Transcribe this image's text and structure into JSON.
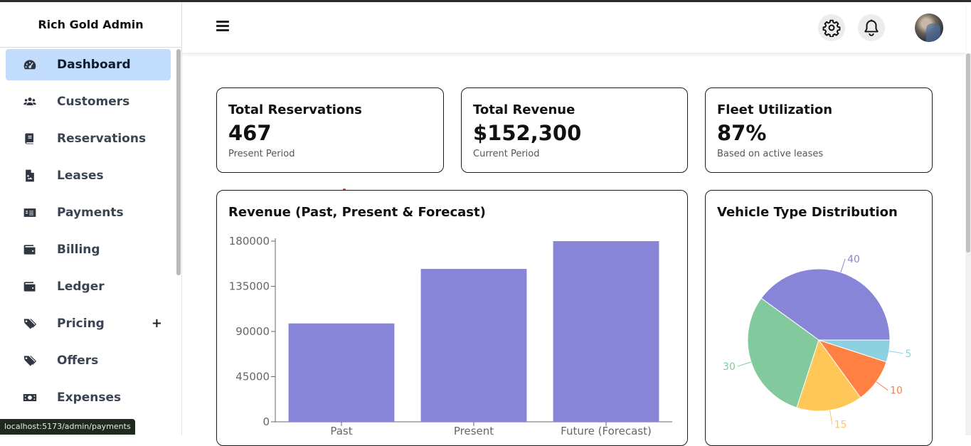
{
  "sidebar": {
    "brand": "Rich Gold Admin",
    "items": [
      {
        "label": "Dashboard",
        "icon": "dashboard-icon",
        "active": true
      },
      {
        "label": "Customers",
        "icon": "users-icon"
      },
      {
        "label": "Reservations",
        "icon": "book-icon"
      },
      {
        "label": "Leases",
        "icon": "file-image-icon"
      },
      {
        "label": "Payments",
        "icon": "money-check-icon"
      },
      {
        "label": "Billing",
        "icon": "wallet-icon"
      },
      {
        "label": "Ledger",
        "icon": "wallet-icon"
      },
      {
        "label": "Pricing",
        "icon": "tags-icon",
        "suffix": "+"
      },
      {
        "label": "Offers",
        "icon": "tags-icon"
      },
      {
        "label": "Expenses",
        "icon": "money-bill-icon"
      }
    ]
  },
  "header": {
    "menu_icon": "hamburger-icon",
    "settings_icon": "gear-icon",
    "notifications_icon": "bell-icon",
    "avatar": "user-avatar"
  },
  "stats": [
    {
      "title": "Total Reservations",
      "value": "467",
      "sub": "Present Period"
    },
    {
      "title": "Total Revenue",
      "value": "$152,300",
      "sub": "Current Period"
    },
    {
      "title": "Fleet Utilization",
      "value": "87%",
      "sub": "Based on active leases"
    }
  ],
  "revenue_chart": {
    "title": "Revenue (Past, Present & Forecast)"
  },
  "vehicle_chart": {
    "title": "Vehicle Type Distribution"
  },
  "status_url": "localhost:5173/admin/payments",
  "colors": {
    "accent": "#c2dcfb",
    "bar": "#8884d8"
  },
  "chart_data": [
    {
      "type": "bar",
      "title": "Revenue (Past, Present & Forecast)",
      "categories": [
        "Past",
        "Present",
        "Future (Forecast)"
      ],
      "values": [
        98000,
        152300,
        180000
      ],
      "yticks": [
        "0",
        "45000",
        "90000",
        "135000",
        "180000"
      ],
      "ylim": [
        0,
        180000
      ],
      "color": "#8884d8",
      "grid": false
    },
    {
      "type": "pie",
      "title": "Vehicle Type Distribution",
      "values": [
        40,
        30,
        15,
        10,
        5
      ],
      "labels": [
        "40",
        "30",
        "15",
        "10",
        "5"
      ],
      "colors": [
        "#8884d8",
        "#82ca9d",
        "#ffc658",
        "#ff8042",
        "#8dd1e1"
      ]
    }
  ]
}
